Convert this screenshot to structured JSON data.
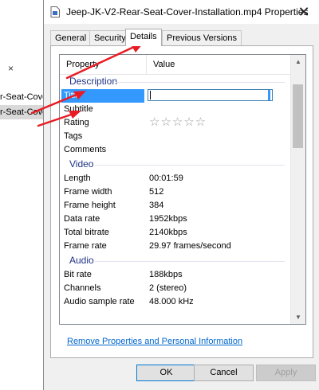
{
  "background_window": {
    "close_glyph": "×",
    "items": [
      "r-Seat-Cove",
      "r-Seat-Cove"
    ]
  },
  "dialog": {
    "title": "Jeep-JK-V2-Rear-Seat-Cover-Installation.mp4 Properties",
    "close_glyph": "✕",
    "tabs": [
      {
        "label": "General"
      },
      {
        "label": "Security"
      },
      {
        "label": "Details",
        "active": true
      },
      {
        "label": "Previous Versions"
      }
    ],
    "columns": {
      "property": "Property",
      "value": "Value"
    },
    "sections": {
      "description": {
        "label": "Description",
        "rows": [
          {
            "key": "Title",
            "value": "",
            "selected": true,
            "editing": true
          },
          {
            "key": "Subtitle",
            "value": ""
          },
          {
            "key": "Rating",
            "stars": "☆☆☆☆☆"
          },
          {
            "key": "Tags",
            "value": ""
          },
          {
            "key": "Comments",
            "value": ""
          }
        ]
      },
      "video": {
        "label": "Video",
        "rows": [
          {
            "key": "Length",
            "value": "00:01:59"
          },
          {
            "key": "Frame width",
            "value": "512"
          },
          {
            "key": "Frame height",
            "value": "384"
          },
          {
            "key": "Data rate",
            "value": "1952kbps"
          },
          {
            "key": "Total bitrate",
            "value": "2140kbps"
          },
          {
            "key": "Frame rate",
            "value": "29.97 frames/second"
          }
        ]
      },
      "audio": {
        "label": "Audio",
        "rows": [
          {
            "key": "Bit rate",
            "value": "188kbps"
          },
          {
            "key": "Channels",
            "value": "2 (stereo)"
          },
          {
            "key": "Audio sample rate",
            "value": "48.000 kHz"
          }
        ]
      }
    },
    "scroll": {
      "up": "▲",
      "down": "▼"
    },
    "remove_link": "Remove Properties and Personal Information",
    "buttons": {
      "ok": "OK",
      "cancel": "Cancel",
      "apply": "Apply"
    }
  },
  "annotations": {
    "arrow_color": "#e81c24"
  }
}
